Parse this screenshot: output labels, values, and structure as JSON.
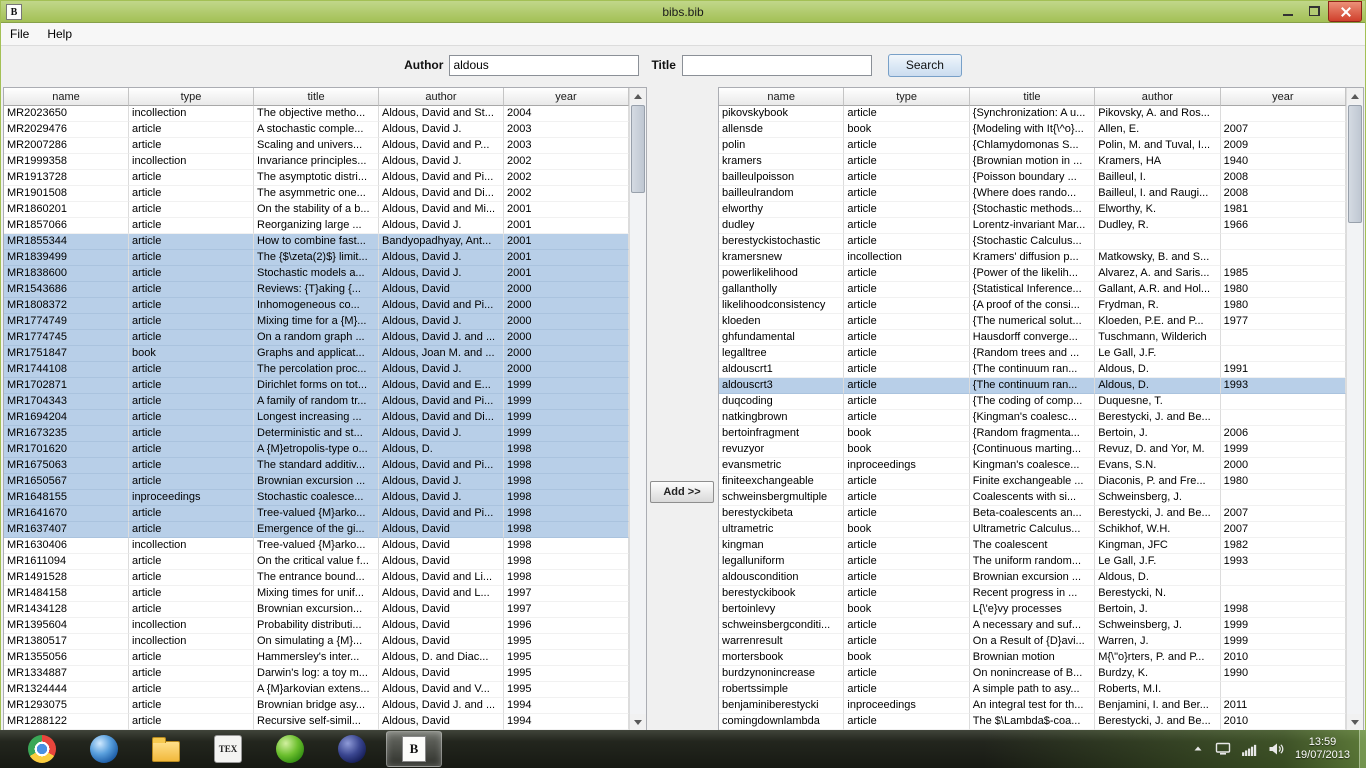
{
  "theme": {
    "titlebar_green": "#a3c055",
    "selection_blue": "#b8cfe8",
    "close_red": "#d0402c",
    "taskbar_dark": "#171913"
  },
  "window": {
    "title": "bibs.bib",
    "app_icon_glyph": "B"
  },
  "menu": {
    "items": [
      "File",
      "Help"
    ]
  },
  "search": {
    "author_label": "Author",
    "author_value": "aldous",
    "title_label": "Title",
    "title_value": "",
    "button_label": "Search"
  },
  "add_button_label": "Add >>",
  "left_table": {
    "columns": [
      "name",
      "type",
      "title",
      "author",
      "year"
    ],
    "selected_rows": [
      8,
      9,
      10,
      11,
      12,
      13,
      14,
      15,
      16,
      17,
      18,
      19,
      20,
      21,
      22,
      23,
      24,
      25,
      26
    ],
    "rows": [
      [
        "MR2023650",
        "incollection",
        "The objective metho...",
        "Aldous, David and St...",
        "2004"
      ],
      [
        "MR2029476",
        "article",
        "A stochastic comple...",
        "Aldous, David J.",
        "2003"
      ],
      [
        "MR2007286",
        "article",
        "Scaling and univers...",
        "Aldous, David and P...",
        "2003"
      ],
      [
        "MR1999358",
        "incollection",
        "Invariance principles...",
        "Aldous, David J.",
        "2002"
      ],
      [
        "MR1913728",
        "article",
        "The asymptotic distri...",
        "Aldous, David and Pi...",
        "2002"
      ],
      [
        "MR1901508",
        "article",
        "The asymmetric one...",
        "Aldous, David and Di...",
        "2002"
      ],
      [
        "MR1860201",
        "article",
        "On the stability of a b...",
        "Aldous, David and Mi...",
        "2001"
      ],
      [
        "MR1857066",
        "article",
        "Reorganizing large ...",
        "Aldous, David J.",
        "2001"
      ],
      [
        "MR1855344",
        "article",
        "How to combine fast...",
        "Bandyopadhyay, Ant...",
        "2001"
      ],
      [
        "MR1839499",
        "article",
        "The {$\\zeta(2)$} limit...",
        "Aldous, David J.",
        "2001"
      ],
      [
        "MR1838600",
        "article",
        "Stochastic models a...",
        "Aldous, David J.",
        "2001"
      ],
      [
        "MR1543686",
        "article",
        "Reviews: {T}aking {...",
        "Aldous, David",
        "2000"
      ],
      [
        "MR1808372",
        "article",
        "Inhomogeneous co...",
        "Aldous, David and Pi...",
        "2000"
      ],
      [
        "MR1774749",
        "article",
        "Mixing time for a {M}...",
        "Aldous, David J.",
        "2000"
      ],
      [
        "MR1774745",
        "article",
        "On a random graph ...",
        "Aldous, David J. and ...",
        "2000"
      ],
      [
        "MR1751847",
        "book",
        "Graphs and applicat...",
        "Aldous, Joan M. and ...",
        "2000"
      ],
      [
        "MR1744108",
        "article",
        "The percolation proc...",
        "Aldous, David J.",
        "2000"
      ],
      [
        "MR1702871",
        "article",
        "Dirichlet forms on tot...",
        "Aldous, David and E...",
        "1999"
      ],
      [
        "MR1704343",
        "article",
        "A family of random tr...",
        "Aldous, David and Pi...",
        "1999"
      ],
      [
        "MR1694204",
        "article",
        "Longest increasing ...",
        "Aldous, David and Di...",
        "1999"
      ],
      [
        "MR1673235",
        "article",
        "Deterministic and st...",
        "Aldous, David J.",
        "1999"
      ],
      [
        "MR1701620",
        "article",
        "A {M}etropolis-type o...",
        "Aldous, D.",
        "1998"
      ],
      [
        "MR1675063",
        "article",
        "The standard additiv...",
        "Aldous, David and Pi...",
        "1998"
      ],
      [
        "MR1650567",
        "article",
        "Brownian excursion ...",
        "Aldous, David J.",
        "1998"
      ],
      [
        "MR1648155",
        "inproceedings",
        "Stochastic coalesce...",
        "Aldous, David J.",
        "1998"
      ],
      [
        "MR1641670",
        "article",
        "Tree-valued {M}arko...",
        "Aldous, David and Pi...",
        "1998"
      ],
      [
        "MR1637407",
        "article",
        "Emergence of the gi...",
        "Aldous, David",
        "1998"
      ],
      [
        "MR1630406",
        "incollection",
        "Tree-valued {M}arko...",
        "Aldous, David",
        "1998"
      ],
      [
        "MR1611094",
        "article",
        "On the critical value f...",
        "Aldous, David",
        "1998"
      ],
      [
        "MR1491528",
        "article",
        "The entrance bound...",
        "Aldous, David and Li...",
        "1998"
      ],
      [
        "MR1484158",
        "article",
        "Mixing times for unif...",
        "Aldous, David and L...",
        "1997"
      ],
      [
        "MR1434128",
        "article",
        "Brownian excursion...",
        "Aldous, David",
        "1997"
      ],
      [
        "MR1395604",
        "incollection",
        "Probability distributi...",
        "Aldous, David",
        "1996"
      ],
      [
        "MR1380517",
        "incollection",
        "On simulating a {M}...",
        "Aldous, David",
        "1995"
      ],
      [
        "MR1355056",
        "article",
        "Hammersley's inter...",
        "Aldous, D. and Diac...",
        "1995"
      ],
      [
        "MR1334887",
        "article",
        "Darwin's log: a toy m...",
        "Aldous, David",
        "1995"
      ],
      [
        "MR1324444",
        "article",
        "A {M}arkovian extens...",
        "Aldous, David and V...",
        "1995"
      ],
      [
        "MR1293075",
        "article",
        "Brownian bridge asy...",
        "Aldous, David J. and ...",
        "1994"
      ],
      [
        "MR1288122",
        "article",
        "Recursive self-simil...",
        "Aldous, David",
        "1994"
      ]
    ]
  },
  "right_table": {
    "columns": [
      "name",
      "type",
      "title",
      "author",
      "year"
    ],
    "selected_rows": [
      17
    ],
    "rows": [
      [
        "pikovskybook",
        "article",
        "{Synchronization: A u...",
        "Pikovsky, A. and Ros...",
        ""
      ],
      [
        "allensde",
        "book",
        "{Modeling with It{\\^o}...",
        "Allen, E.",
        "2007"
      ],
      [
        "polin",
        "article",
        "{Chlamydomonas S...",
        "Polin, M. and Tuval, I...",
        "2009"
      ],
      [
        "kramers",
        "article",
        "{Brownian motion in ...",
        "Kramers, HA",
        "1940"
      ],
      [
        "bailleulpoisson",
        "article",
        "{Poisson boundary ...",
        "Bailleul, I.",
        "2008"
      ],
      [
        "bailleulrandom",
        "article",
        "{Where does rando...",
        "Bailleul, I. and Raugi...",
        "2008"
      ],
      [
        "elworthy",
        "article",
        "{Stochastic methods...",
        "Elworthy, K.",
        "1981"
      ],
      [
        "dudley",
        "article",
        "Lorentz-invariant Mar...",
        "Dudley, R.",
        "1966"
      ],
      [
        "berestyckistochastic",
        "article",
        "{Stochastic Calculus...",
        "",
        ""
      ],
      [
        "kramersnew",
        "incollection",
        "Kramers' diffusion p...",
        "Matkowsky, B. and S...",
        ""
      ],
      [
        "powerlikelihood",
        "article",
        "{Power of the likelih...",
        "Alvarez, A. and Saris...",
        "1985"
      ],
      [
        "gallantholly",
        "article",
        "{Statistical Inference...",
        "Gallant, A.R. and Hol...",
        "1980"
      ],
      [
        "likelihoodconsistency",
        "article",
        "{A proof of the consi...",
        "Frydman, R.",
        "1980"
      ],
      [
        "kloeden",
        "article",
        "{The numerical solut...",
        "Kloeden, P.E. and P...",
        "1977"
      ],
      [
        "ghfundamental",
        "article",
        "Hausdorff converge...",
        "Tuschmann, Wilderich",
        ""
      ],
      [
        "legalltree",
        "article",
        "{Random trees and ...",
        "Le Gall, J.F.",
        ""
      ],
      [
        "aldouscrt1",
        "article",
        "{The continuum ran...",
        "Aldous, D.",
        "1991"
      ],
      [
        "aldouscrt3",
        "article",
        "{The continuum ran...",
        "Aldous, D.",
        "1993"
      ],
      [
        "duqcoding",
        "article",
        "{The coding of comp...",
        "Duquesne, T.",
        ""
      ],
      [
        "natkingbrown",
        "article",
        "{Kingman's coalesc...",
        "Berestycki, J. and Be...",
        ""
      ],
      [
        "bertoinfragment",
        "book",
        "{Random fragmenta...",
        "Bertoin, J.",
        "2006"
      ],
      [
        "revuzyor",
        "book",
        "{Continuous marting...",
        "Revuz, D. and Yor, M.",
        "1999"
      ],
      [
        "evansmetric",
        "inproceedings",
        "Kingman's coalesce...",
        "Evans, S.N.",
        "2000"
      ],
      [
        "finiteexchangeable",
        "article",
        "Finite exchangeable ...",
        "Diaconis, P. and Fre...",
        "1980"
      ],
      [
        "schweinsbergmultiple",
        "article",
        "Coalescents with si...",
        "Schweinsberg, J.",
        ""
      ],
      [
        "berestyckibeta",
        "article",
        "Beta-coalescents an...",
        "Berestycki, J. and Be...",
        "2007"
      ],
      [
        "ultrametric",
        "book",
        "Ultrametric Calculus...",
        "Schikhof, W.H.",
        "2007"
      ],
      [
        "kingman",
        "article",
        "The coalescent",
        "Kingman, JFC",
        "1982"
      ],
      [
        "legalluniform",
        "article",
        "The uniform random...",
        "Le Gall, J.F.",
        "1993"
      ],
      [
        "aldouscondition",
        "article",
        "Brownian excursion ...",
        "Aldous, D.",
        ""
      ],
      [
        "berestyckibook",
        "article",
        "Recent progress in ...",
        "Berestycki, N.",
        ""
      ],
      [
        "bertoinlevy",
        "book",
        "L{\\'e}vy processes",
        "Bertoin, J.",
        "1998"
      ],
      [
        "schweinsbergconditi...",
        "article",
        "A necessary and suf...",
        "Schweinsberg, J.",
        "1999"
      ],
      [
        "warrenresult",
        "article",
        "On a Result of {D}avi...",
        "Warren, J.",
        "1999"
      ],
      [
        "mortersbook",
        "book",
        "Brownian motion",
        "M{\\\"o}rters, P. and P...",
        "2010"
      ],
      [
        "burdzynonincrease",
        "article",
        "On nonincrease of B...",
        "Burdzy, K.",
        "1990"
      ],
      [
        "robertssimple",
        "article",
        "A simple path to asy...",
        "Roberts, M.I.",
        ""
      ],
      [
        "benjaminiberestycki",
        "inproceedings",
        "An integral test for th...",
        "Benjamini, I. and Ber...",
        "2011"
      ],
      [
        "comingdownlambda",
        "article",
        "The $\\Lambda$-coa...",
        "Berestycki, J. and Be...",
        "2010"
      ]
    ]
  },
  "taskbar": {
    "apps": [
      {
        "icon": "chrome-icon"
      },
      {
        "icon": "browser-globe-icon"
      },
      {
        "icon": "file-manager-icon"
      },
      {
        "icon": "tex-icon",
        "glyph": "TEX"
      },
      {
        "icon": "media-green-icon"
      },
      {
        "icon": "globe-dark-icon"
      },
      {
        "icon": "bibtex-icon",
        "glyph": "B",
        "active": true
      }
    ],
    "tray_icons": [
      "hidden-icons-icon",
      "display-icon",
      "network-signal-icon",
      "volume-icon"
    ],
    "clock": {
      "time": "13:59",
      "date": "19/07/2013"
    }
  }
}
